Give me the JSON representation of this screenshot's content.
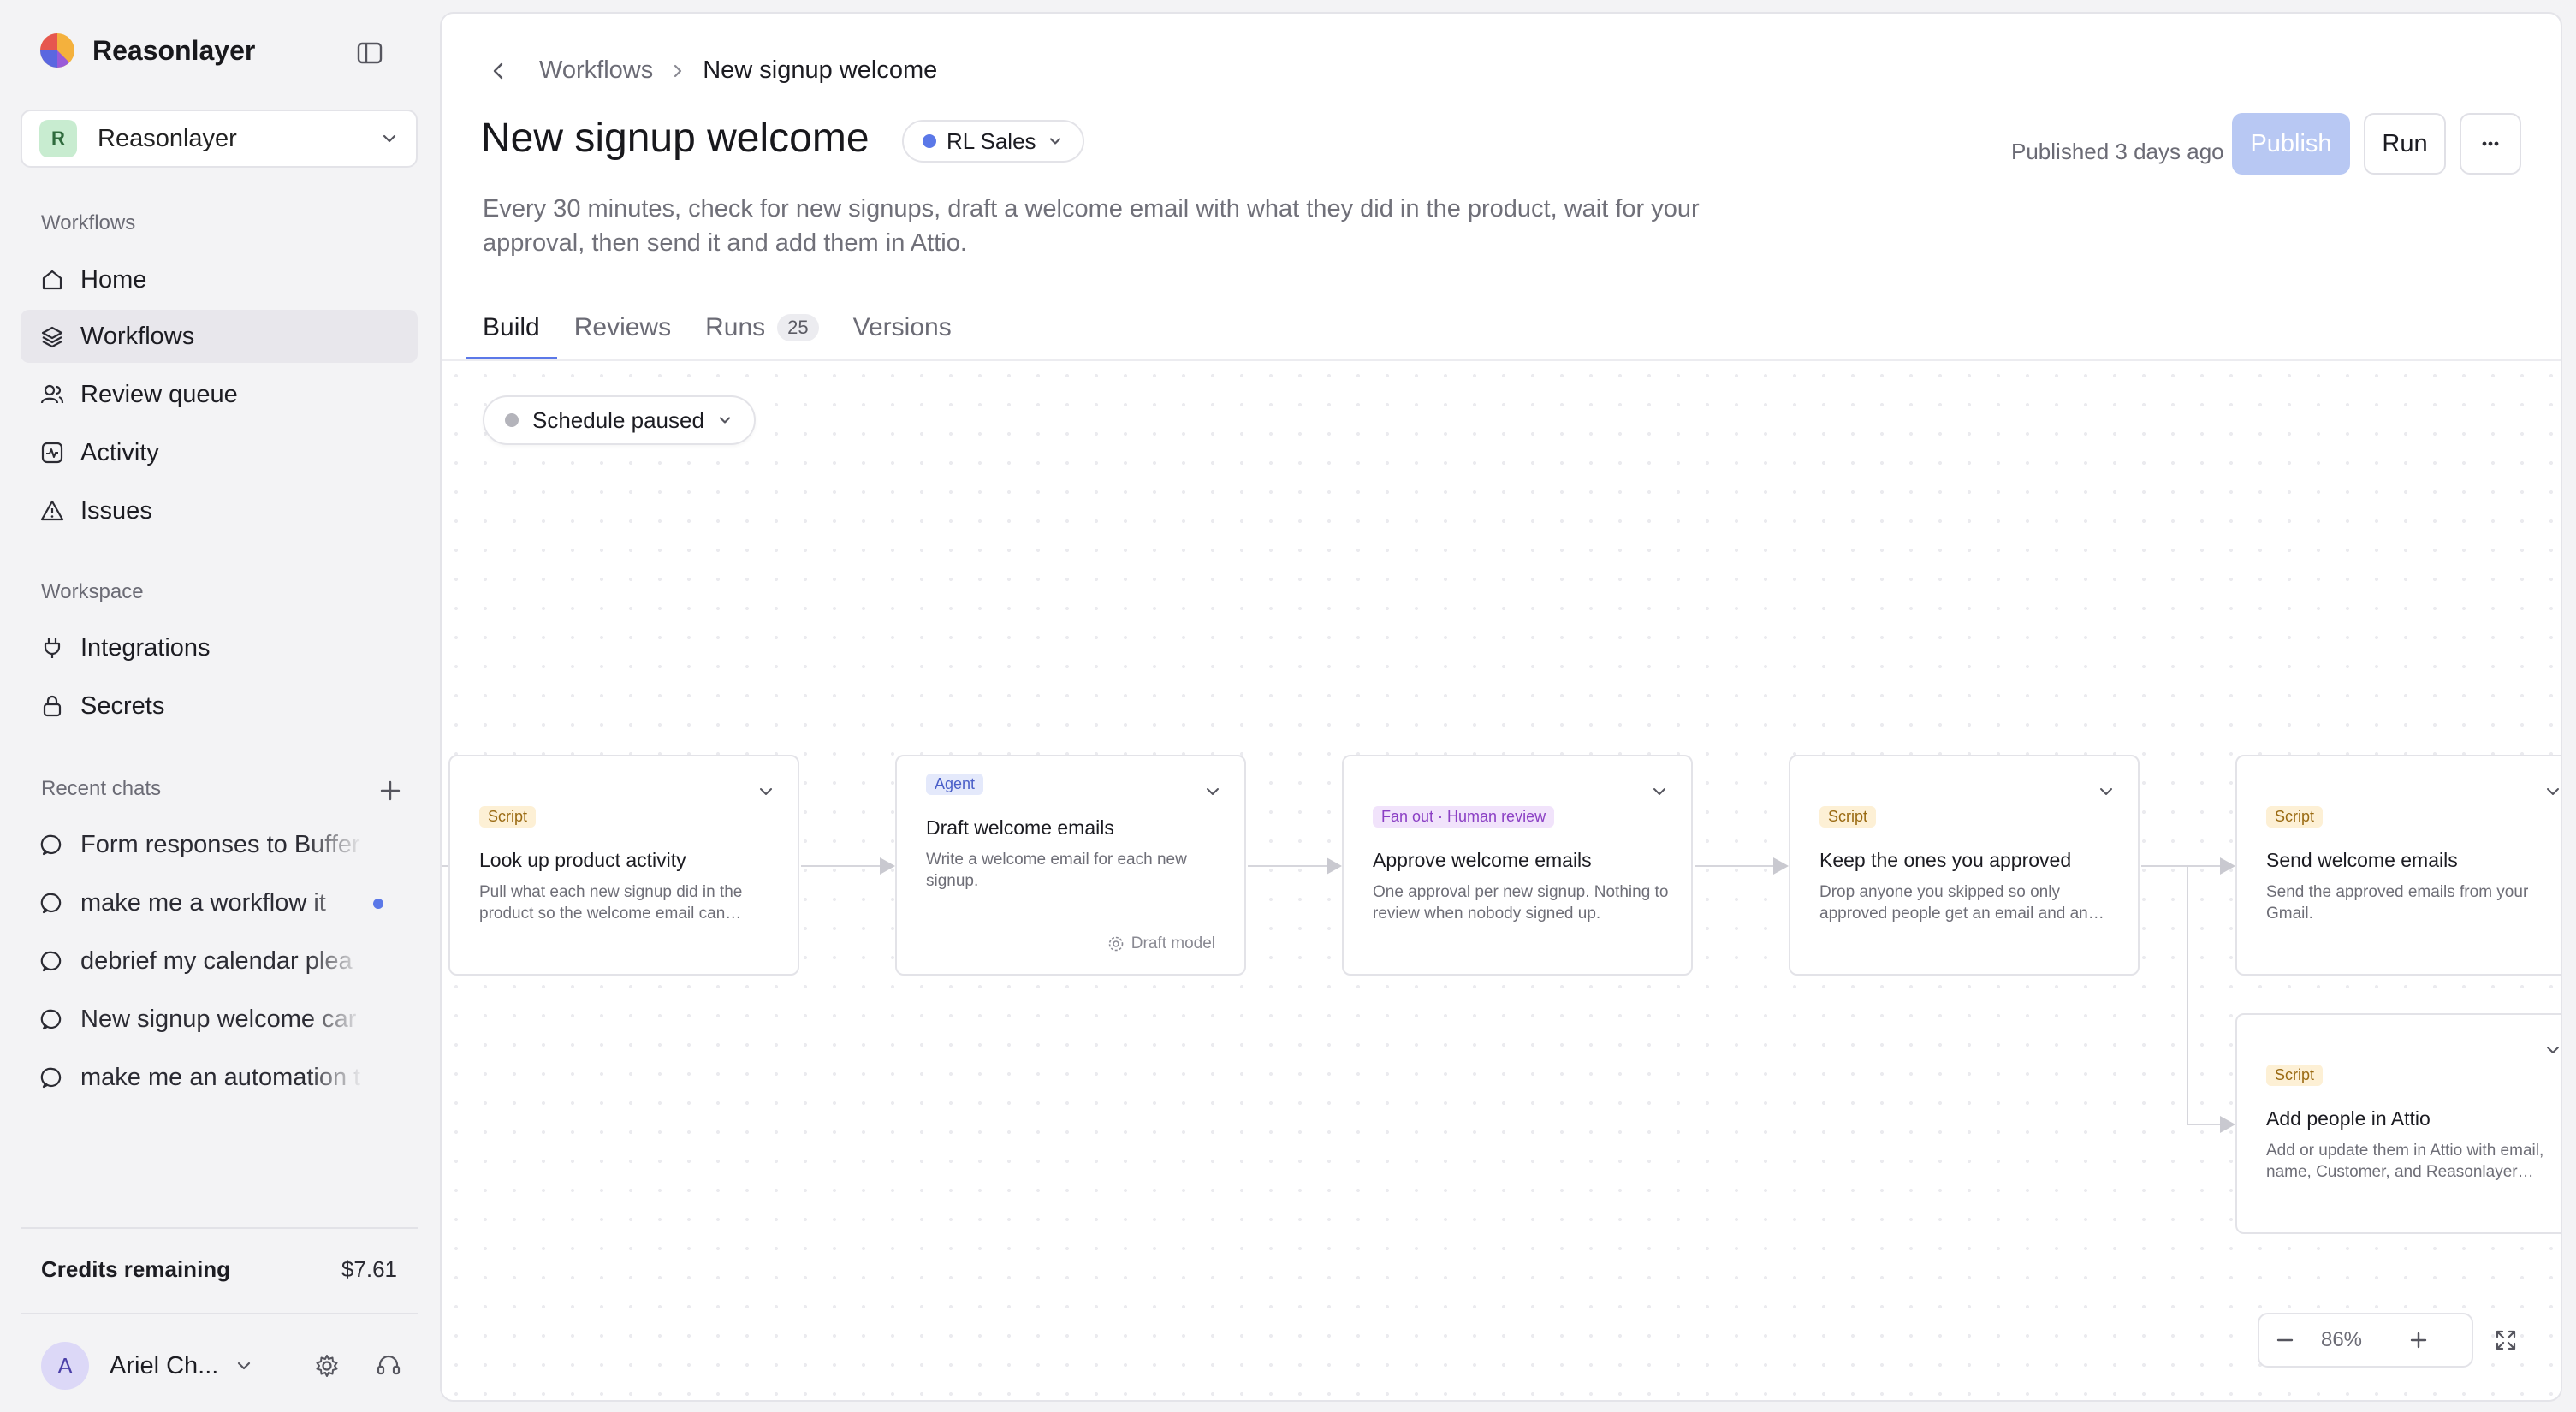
{
  "app": {
    "name": "Reasonlayer",
    "logo_icon": "reasonlayer-logo-icon"
  },
  "workspace": {
    "initial": "R",
    "name": "Reasonlayer"
  },
  "sidebar": {
    "workflows_heading": "Workflows",
    "nav": [
      {
        "label": "Home",
        "icon": "home-icon",
        "active": false
      },
      {
        "label": "Workflows",
        "icon": "layers-icon",
        "active": true
      },
      {
        "label": "Review queue",
        "icon": "users-icon",
        "active": false
      },
      {
        "label": "Activity",
        "icon": "activity-icon",
        "active": false
      },
      {
        "label": "Issues",
        "icon": "warning-icon",
        "active": false
      }
    ],
    "workspace_heading": "Workspace",
    "workspace_nav": [
      {
        "label": "Integrations",
        "icon": "plug-icon"
      },
      {
        "label": "Secrets",
        "icon": "lock-icon"
      }
    ],
    "recent_heading": "Recent chats",
    "recent_chats": [
      {
        "label": "Form responses to Buffer",
        "unread": false
      },
      {
        "label": "make me a workflow it",
        "unread": true
      },
      {
        "label": "debrief my calendar plea",
        "unread": false
      },
      {
        "label": "New signup welcome car",
        "unread": false
      },
      {
        "label": "make me an automation t",
        "unread": false
      }
    ],
    "credits_label": "Credits remaining",
    "credits_value": "$7.61",
    "user": {
      "initial": "A",
      "name": "Ariel Ch..."
    }
  },
  "breadcrumb": {
    "parent": "Workflows",
    "current": "New signup welcome"
  },
  "workflow": {
    "title": "New signup welcome",
    "team": "RL Sales",
    "team_color": "#5b78e8",
    "published": "Published 3 days ago",
    "publish_label": "Publish",
    "run_label": "Run",
    "description": "Every 30 minutes, check for new signups, draft a welcome email with what they did in the product, wait for your approval, then send it and add them in Attio."
  },
  "tabs": [
    {
      "label": "Build",
      "active": true,
      "badge": ""
    },
    {
      "label": "Reviews",
      "active": false,
      "badge": ""
    },
    {
      "label": "Runs",
      "active": false,
      "badge": "25"
    },
    {
      "label": "Versions",
      "active": false,
      "badge": ""
    }
  ],
  "schedule": {
    "label": "Schedule paused"
  },
  "nodes": [
    {
      "tag": "Script",
      "title": "Look up product activity",
      "desc": "Pull what each new signup did in the product so the welcome email can reference it."
    },
    {
      "tag": "Agent",
      "title": "Draft welcome emails",
      "desc": "Write a welcome email for each new signup.",
      "model": "Draft model"
    },
    {
      "tag": "Fan out · Human review",
      "title": "Approve welcome emails",
      "desc": "One approval per new signup. Nothing to review when nobody signed up."
    },
    {
      "tag": "Script",
      "title": "Keep the ones you approved",
      "desc": "Drop anyone you skipped so only approved people get an email and an Attio record."
    },
    {
      "tag": "Script",
      "title": "Send welcome emails",
      "desc": "Send the approved emails from your Gmail."
    },
    {
      "tag": "Script",
      "title": "Add people in Attio",
      "desc": "Add or update them in Attio with email, name, Customer, and Reasonlayer signup details."
    }
  ],
  "zoom": {
    "value": "86%"
  },
  "colors": {
    "accent": "#5b78e8",
    "publish_disabled": "#b8c8f3"
  }
}
